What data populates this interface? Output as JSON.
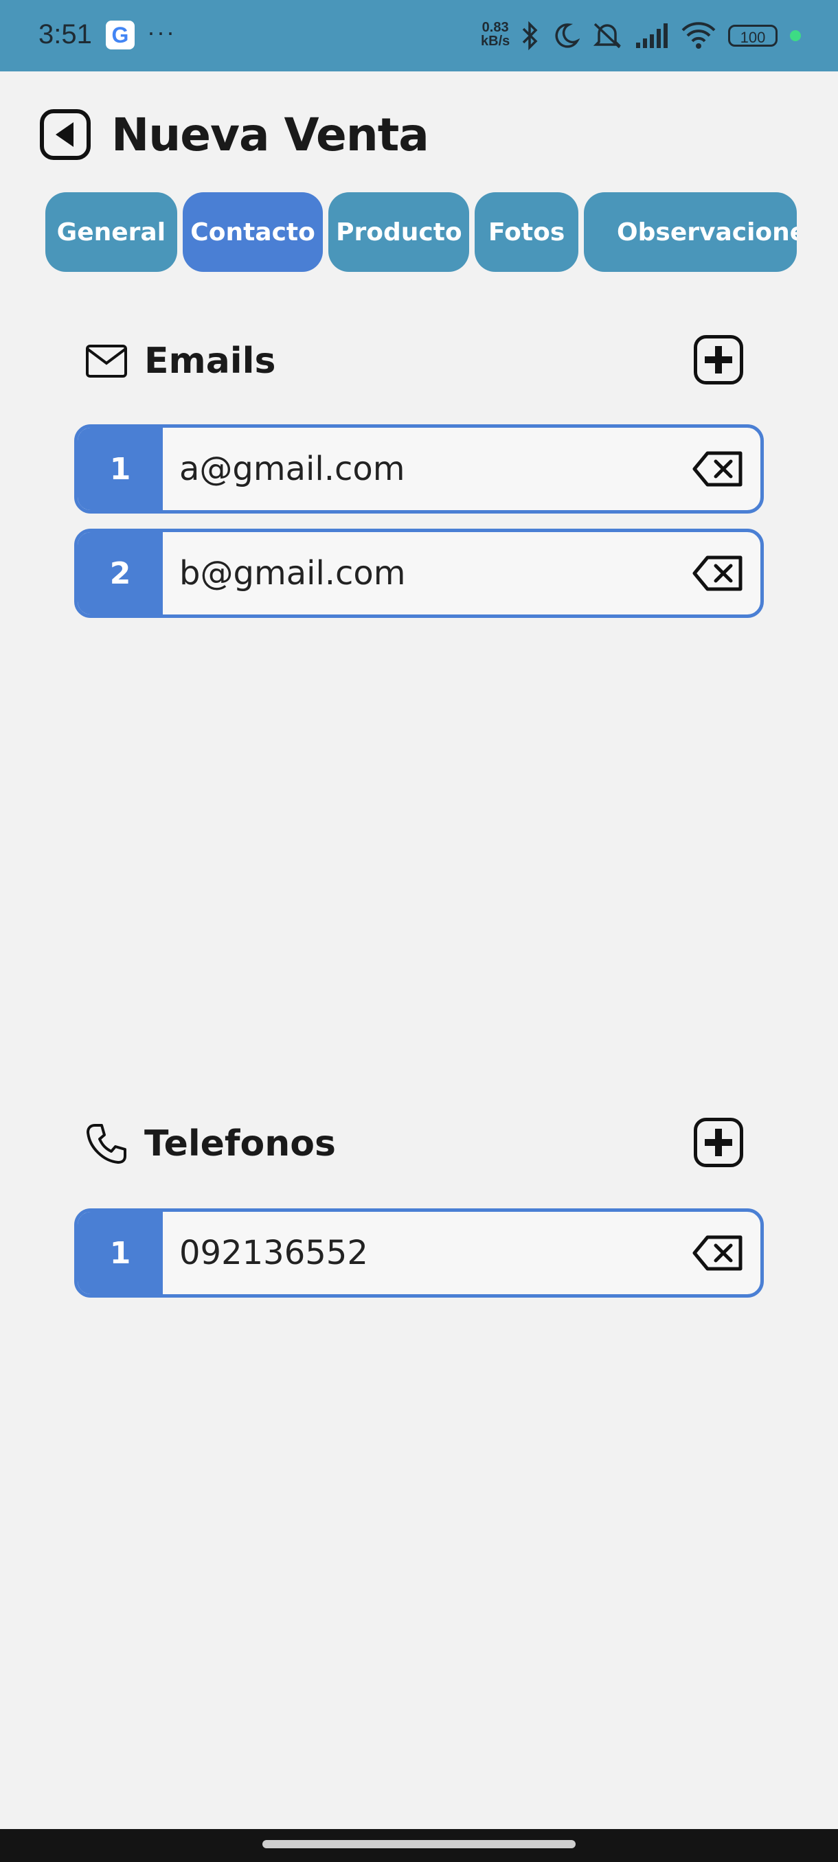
{
  "status_bar": {
    "time": "3:51",
    "google_glyph": "G",
    "overflow": "···",
    "speed_value": "0.83",
    "speed_unit": "kB/s",
    "battery": "100",
    "icons": [
      "bluetooth-icon",
      "moon-icon",
      "mute-icon",
      "signal-icon",
      "wifi-icon",
      "battery-icon"
    ]
  },
  "header": {
    "title": "Nueva Venta",
    "back_icon": "back-arrow-icon"
  },
  "tabs": [
    {
      "label": "General",
      "active": false
    },
    {
      "label": "Contacto",
      "active": true
    },
    {
      "label": "Producto",
      "active": false
    },
    {
      "label": "Fotos",
      "active": false
    },
    {
      "label": "Observaciones",
      "active": false
    }
  ],
  "emails": {
    "title": "Emails",
    "icon": "mail-icon",
    "items": [
      {
        "index": "1",
        "value": "a@gmail.com"
      },
      {
        "index": "2",
        "value": "b@gmail.com"
      }
    ]
  },
  "phones": {
    "title": "Telefonos",
    "icon": "phone-icon",
    "items": [
      {
        "index": "1",
        "value": "092136552"
      }
    ]
  },
  "colors": {
    "status_bar": "#4a96ba",
    "tab": "#4a96ba",
    "tab_active": "#4a7fd4",
    "entry_accent": "#4a7fd4",
    "background": "#f2f2f2"
  }
}
